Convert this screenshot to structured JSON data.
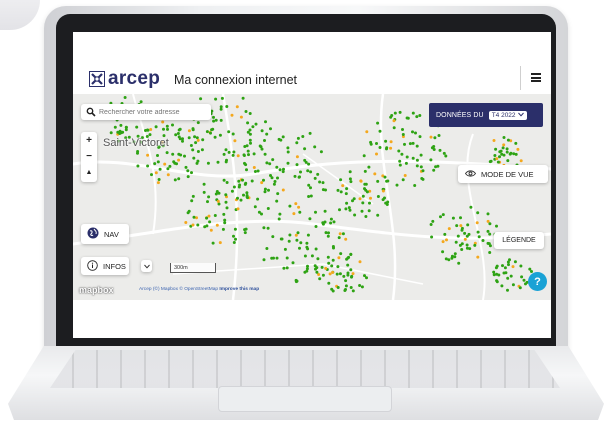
{
  "header": {
    "logo_text": "arcep",
    "app_title": "Ma connexion internet"
  },
  "map": {
    "search_placeholder": "Rechercher votre adresse",
    "data_label": "DONNÉES DU",
    "period_value": "T4 2022",
    "zoom_in": "+",
    "zoom_out": "−",
    "compass": "▲",
    "place_name": "Saint-Victoret",
    "view_mode_label": "MODE DE VUE",
    "legend_label": "LÉGENDE",
    "nav_label": "NAV",
    "infos_label": "INFOS",
    "scale_label": "300m",
    "mapbox_label": "mapbox",
    "attribution_text": "Arcep (©) Mapbox © OpenStreetMap",
    "improve_link": "Improve this map",
    "help_label": "?"
  },
  "colors": {
    "brand_navy": "#2b2f6a",
    "dot_green": "#2ea314",
    "dot_orange": "#f4a81d",
    "help_blue": "#1aa2d5"
  }
}
